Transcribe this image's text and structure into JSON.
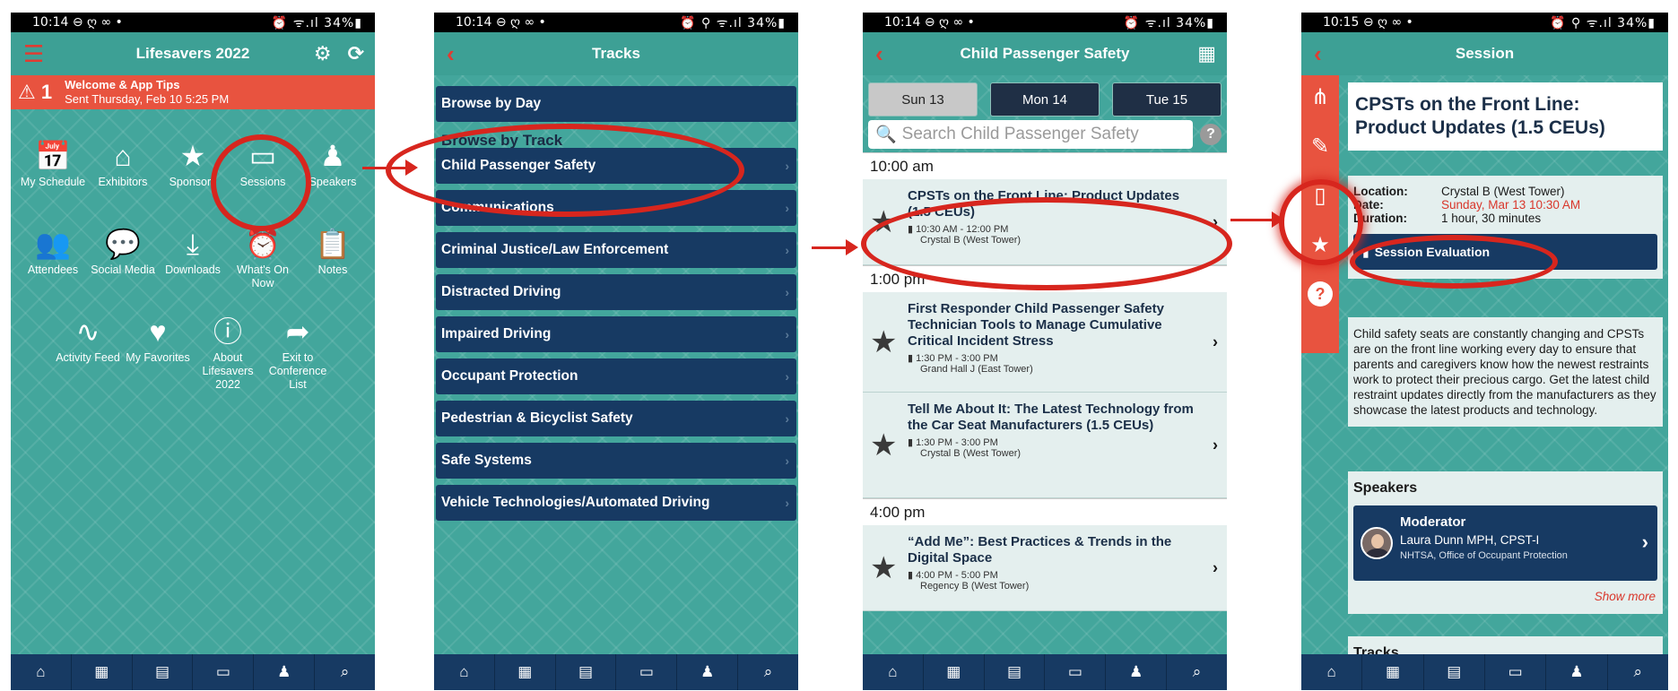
{
  "accent": {
    "red": "#e8533f",
    "navy": "#173a63",
    "teal": "#43a69c"
  },
  "status_bars": [
    {
      "time": "10:14",
      "left_icons": "⊖ ღ ∞ •",
      "right": "⏰ ᯤ.ıl 34%▮"
    },
    {
      "time": "10:14",
      "left_icons": "⊖ ღ ∞ •",
      "right": "⏰ ⚲ ᯤ.ıl 34%▮"
    },
    {
      "time": "10:14",
      "left_icons": "⊖ ღ ∞ •",
      "right": "⏰ ᯤ.ıl 34%▮"
    },
    {
      "time": "10:15",
      "left_icons": "⊖ ღ ∞ •",
      "right": "⏰ ⚲ ᯤ.ıl 34%▮"
    }
  ],
  "home": {
    "title": "Lifesavers 2022",
    "alert": {
      "count": "1",
      "title": "Welcome & App Tips",
      "subtitle": "Sent Thursday, Feb 10 5:25 PM"
    },
    "tiles": [
      {
        "label": "My Schedule",
        "icon": "calendar-icon"
      },
      {
        "label": "Exhibitors",
        "icon": "booth-icon"
      },
      {
        "label": "Sponsors",
        "icon": "star-icon"
      },
      {
        "label": "Sessions",
        "icon": "easel-icon"
      },
      {
        "label": "Speakers",
        "icon": "speaker-icon"
      },
      {
        "label": "Attendees",
        "icon": "people-icon"
      },
      {
        "label": "Social Media",
        "icon": "chat-icon"
      },
      {
        "label": "Downloads",
        "icon": "download-icon"
      },
      {
        "label": "What's On Now",
        "icon": "clock-icon"
      },
      {
        "label": "Notes",
        "icon": "clipboard-icon"
      },
      {
        "label": "Activity Feed",
        "icon": "pulse-icon"
      },
      {
        "label": "My Favorites",
        "icon": "heart-icon"
      },
      {
        "label": "About Lifesavers 2022",
        "icon": "info-icon"
      },
      {
        "label": "Exit to Conference List",
        "icon": "share-icon"
      }
    ]
  },
  "tracks": {
    "title": "Tracks",
    "browse_by_day": "Browse by Day",
    "browse_by_track": "Browse by Track",
    "items": [
      "Child Passenger Safety",
      "Communications",
      "Criminal Justice/Law Enforcement",
      "Distracted Driving",
      "Impaired Driving",
      "Occupant Protection",
      "Pedestrian & Bicyclist Safety",
      "Safe Systems",
      "Vehicle Technologies/Automated Driving"
    ]
  },
  "schedule": {
    "title": "Child Passenger Safety",
    "days": [
      "Sun 13",
      "Mon 14",
      "Tue 15"
    ],
    "search_placeholder": "Search Child Passenger Safety",
    "groups": [
      {
        "time": "10:00 am",
        "sessions": [
          {
            "title": "CPSTs on the Front Line: Product Updates (1.5 CEUs)",
            "time": "10:30 AM - 12:00 PM",
            "room": "Crystal B (West Tower)"
          }
        ]
      },
      {
        "time": "1:00 pm",
        "sessions": [
          {
            "title": "First Responder Child Passenger Safety Technician Tools to Manage Cumulative Critical Incident Stress",
            "time": "1:30 PM - 3:00 PM",
            "room": "Grand Hall J (East Tower)"
          },
          {
            "title": "Tell Me About It: The Latest Technology from the Car Seat Manufacturers (1.5 CEUs)",
            "time": "1:30 PM - 3:00 PM",
            "room": "Crystal B (West Tower)"
          }
        ]
      },
      {
        "time": "4:00 pm",
        "sessions": [
          {
            "title": "“Add Me”: Best Practices & Trends in the Digital Space",
            "time": "4:00 PM - 5:00 PM",
            "room": "Regency B (West Tower)"
          }
        ]
      }
    ]
  },
  "detail": {
    "title": "Session",
    "session_title": "CPSTs on the Front Line: Product Updates (1.5 CEUs)",
    "location_label": "Location:",
    "location": "Crystal B (West Tower)",
    "date_label": "Date:",
    "date": "Sunday, Mar 13 10:30 AM",
    "duration_label": "Duration:",
    "duration": "1 hour, 30 minutes",
    "evaluation": "Session Evaluation",
    "description": "Child safety seats are constantly changing and CPSTs are on the front line working every day to ensure that parents and caregivers know how the newest restraints work to protect their precious cargo. Get the latest child restraint updates directly from the manufacturers as they showcase the latest products and technology.",
    "speakers_head": "Speakers",
    "speaker_role": "Moderator",
    "speaker_name": "Laura Dunn MPH, CPST-I",
    "speaker_org": "NHTSA, Office of Occupant Protection",
    "show_more": "Show more",
    "tracks_head": "Tracks"
  },
  "nav_icons": [
    "home-icon",
    "booth-icon",
    "calendar-icon",
    "easel-icon",
    "speaker-icon",
    "search-icon"
  ]
}
